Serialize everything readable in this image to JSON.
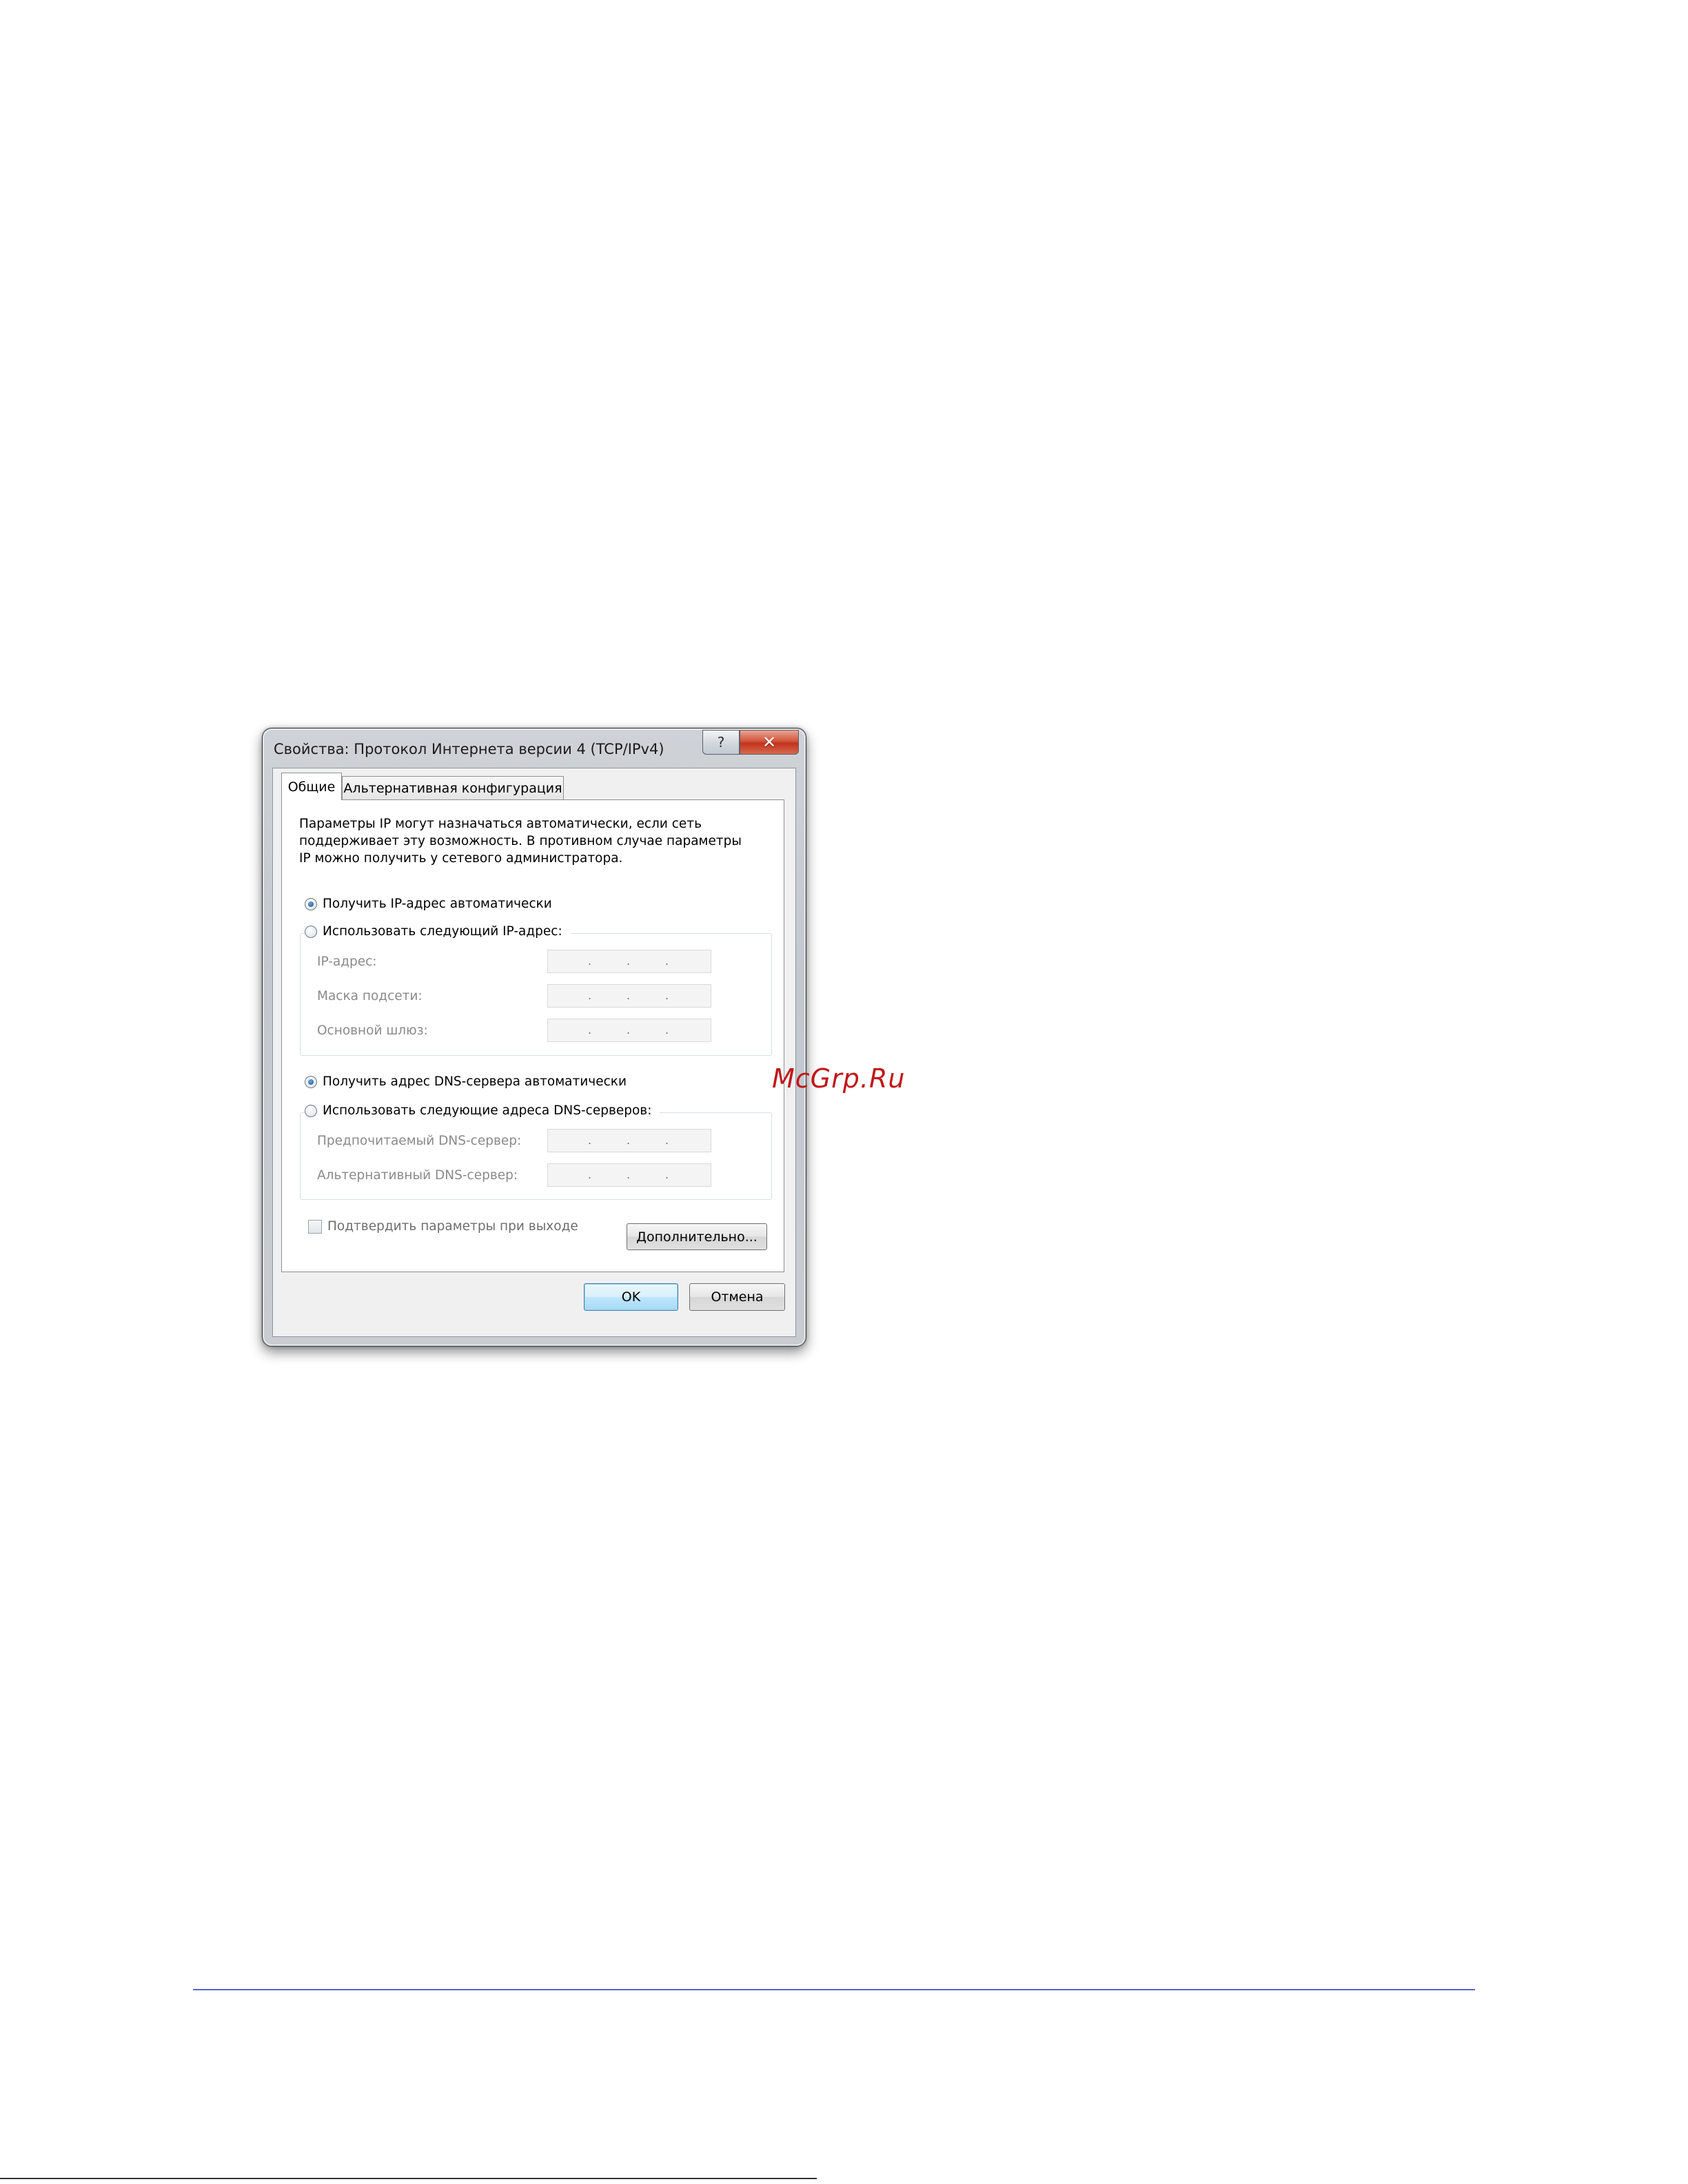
{
  "dialog": {
    "title": "Свойства: Протокол Интернета версии 4 (TCP/IPv4)",
    "help_glyph": "?",
    "close_glyph": "✕",
    "tabs": [
      {
        "label": "Общие",
        "active": true
      },
      {
        "label": "Альтернативная конфигурация",
        "active": false
      }
    ],
    "description": [
      "Параметры IP могут назначаться автоматически, если сеть",
      "поддерживает эту возможность. В противном случае параметры",
      "IP можно получить у сетевого администратора."
    ],
    "ip_mode": {
      "auto_label": "Получить IP-адрес автоматически",
      "manual_label": "Использовать следующий IP-адрес:",
      "selected": "auto"
    },
    "ip_fields": [
      {
        "label": "IP-адрес:",
        "value": ". . ."
      },
      {
        "label": "Маска подсети:",
        "value": ". . ."
      },
      {
        "label": "Основной шлюз:",
        "value": ". . ."
      }
    ],
    "dns_mode": {
      "auto_label": "Получить адрес DNS-сервера автоматически",
      "manual_label": "Использовать следующие адреса DNS-серверов:",
      "selected": "auto"
    },
    "dns_fields": [
      {
        "label": "Предпочитаемый DNS-сервер:",
        "value": ". . ."
      },
      {
        "label": "Альтернативный DNS-сервер:",
        "value": ". . ."
      }
    ],
    "validate_label": "Подтвердить параметры при выходе",
    "validate_checked": false,
    "advanced_label": "Дополнительно...",
    "ok_label": "OK",
    "cancel_label": "Отмена"
  },
  "watermark": "McGrp.Ru",
  "colors": {
    "watermark": "#c0171b",
    "rule": "#5a62d6",
    "close_button": "#c1331c",
    "radio_selected": "#1d4f8a"
  }
}
